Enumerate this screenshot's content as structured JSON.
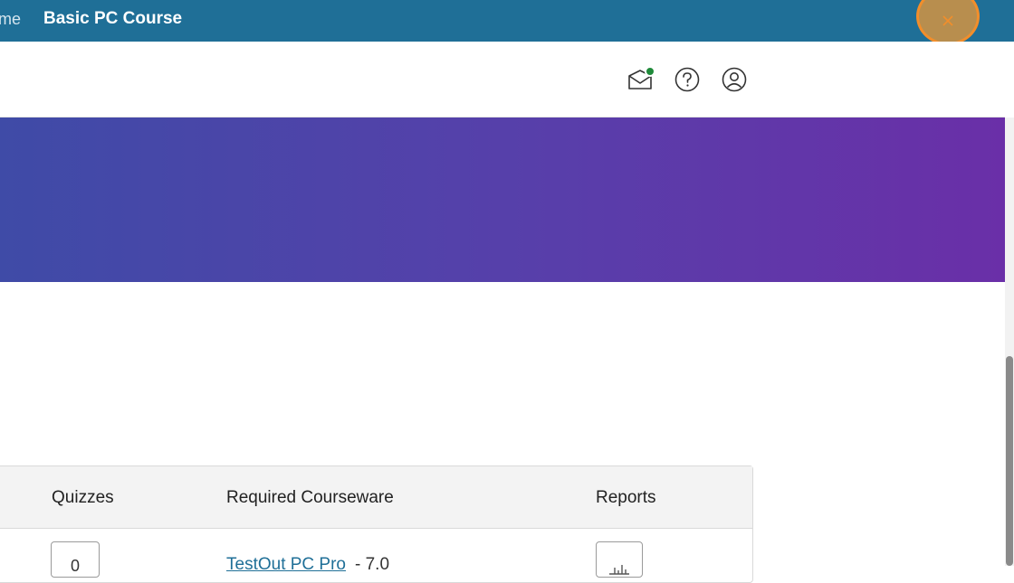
{
  "topbar": {
    "previous_crumb": "ame",
    "current_crumb": "Basic PC Course"
  },
  "header": {
    "icons": [
      "mail-icon",
      "help-icon",
      "user-account-icon"
    ],
    "notification_color": "#1f8a3a"
  },
  "banner": {
    "gradient_start": "#3f4ba7",
    "gradient_end": "#6a2fa8"
  },
  "table": {
    "headers": {
      "quizzes": "Quizzes",
      "courseware": "Required Courseware",
      "reports": "Reports"
    },
    "rows": [
      {
        "quizzes": "0",
        "courseware_link": "TestOut PC Pro",
        "courseware_version": "- 7.0"
      }
    ]
  },
  "colors": {
    "topbar": "#1f6f97",
    "close_button_ring": "#f28e2b",
    "link": "#1f6f97"
  }
}
